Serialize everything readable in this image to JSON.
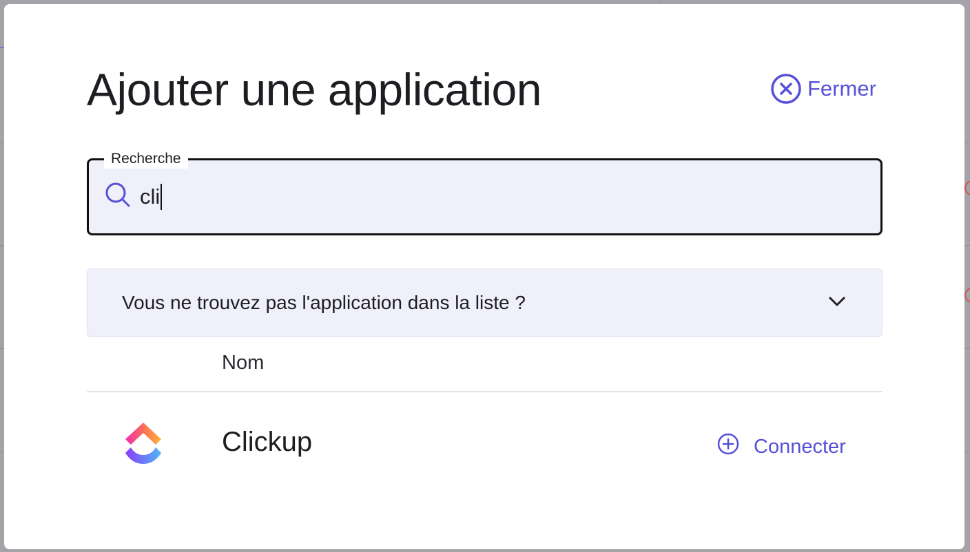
{
  "modal": {
    "title": "Ajouter une application",
    "close_label": "Fermer"
  },
  "search": {
    "label": "Recherche",
    "value": "cli"
  },
  "accordion": {
    "label": "Vous ne trouvez pas l'application dans la liste ?"
  },
  "table": {
    "columns": [
      "Nom"
    ],
    "rows": [
      {
        "name": "Clickup",
        "action_label": "Connecter",
        "logo": "clickup-logo"
      }
    ]
  },
  "colors": {
    "accent": "#5650d8",
    "input_bg": "#f0f0fb",
    "text": "#1d1d22"
  },
  "icons": {
    "close": "close-circle-icon",
    "search": "search-icon",
    "chevron": "chevron-down-icon",
    "connect": "plus-circle-icon"
  }
}
